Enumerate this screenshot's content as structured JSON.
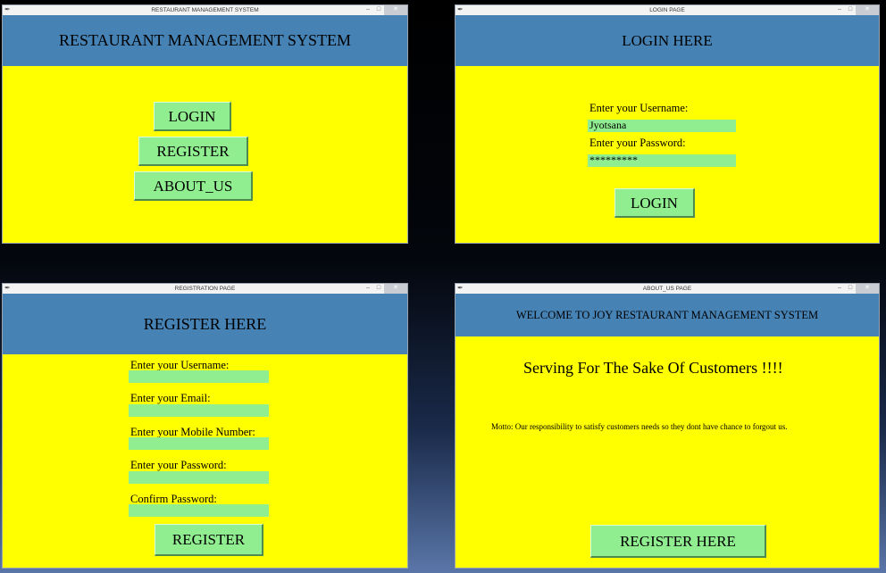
{
  "main_window": {
    "title": "RESTAURANT MANAGEMENT SYSTEM",
    "header": "RESTAURANT MANAGEMENT SYSTEM",
    "buttons": {
      "login": "LOGIN",
      "register": "REGISTER",
      "about": "ABOUT_US"
    }
  },
  "login_window": {
    "title": "LOGIN PAGE",
    "header": "LOGIN HERE",
    "username_label": "Enter your Username:",
    "username_value": "Jyotsana",
    "password_label": "Enter your Password:",
    "password_value": "*********",
    "login_button": "LOGIN"
  },
  "register_window": {
    "title": "REGISTRATION PAGE",
    "header": "REGISTER HERE",
    "username_label": "Enter your Username:",
    "email_label": "Enter your Email:",
    "mobile_label": "Enter your Mobile Number:",
    "password_label": "Enter your Password:",
    "confirm_label": "Confirm Password:",
    "register_button": "REGISTER"
  },
  "about_window": {
    "title": "ABOUT_US PAGE",
    "header": "WELCOME TO JOY RESTAURANT MANAGEMENT SYSTEM",
    "tagline": "Serving For The Sake Of Customers !!!!",
    "motto": "Motto: Our responsibility to satisfy customers needs so they dont have chance to forgout us.",
    "register_button": "REGISTER HERE"
  },
  "window_controls": {
    "minimize": "–",
    "maximize": "□",
    "close": "✕"
  },
  "colors": {
    "header": "#4682b4",
    "body": "#ffff00",
    "widget": "#90ee90"
  },
  "icons": {
    "app": "feather-icon"
  }
}
